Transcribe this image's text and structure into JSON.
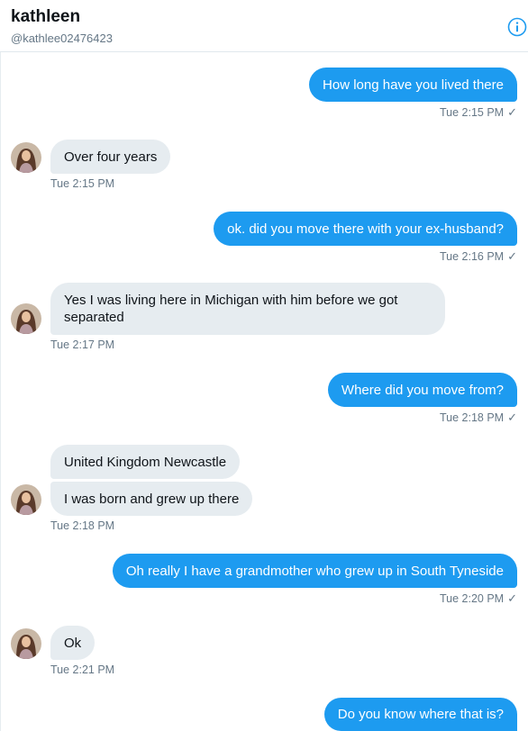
{
  "header": {
    "name": "kathleen",
    "handle": "@kathlee02476423"
  },
  "messages": [
    {
      "id": "m1",
      "direction": "out",
      "text": "How long have you lived there",
      "time": "Tue 2:15 PM",
      "read": "✓"
    },
    {
      "id": "m2",
      "direction": "in",
      "text": "Over four years",
      "time": "Tue 2:15 PM"
    },
    {
      "id": "m3",
      "direction": "out",
      "text": "ok. did you move there with your ex-husband?",
      "time": "Tue 2:16 PM",
      "read": "✓"
    },
    {
      "id": "m4",
      "direction": "in",
      "text": "Yes I was living here in Michigan with him before we got separated",
      "time": "Tue 2:17 PM"
    },
    {
      "id": "m5",
      "direction": "out",
      "text": "Where did you move from?",
      "time": "Tue 2:18 PM",
      "read": "✓"
    },
    {
      "id": "m6",
      "direction": "in",
      "text": "United Kingdom Newcastle"
    },
    {
      "id": "m7",
      "direction": "in",
      "text": "I was born and grew up there",
      "time": "Tue 2:18 PM"
    },
    {
      "id": "m8",
      "direction": "out",
      "text": "Oh really I have a grandmother who grew up in South Tyneside",
      "time": "Tue 2:20 PM",
      "read": "✓"
    },
    {
      "id": "m9",
      "direction": "in",
      "text": "Ok",
      "time": "Tue 2:21 PM"
    },
    {
      "id": "m10",
      "direction": "out",
      "text": "Do you know where that is?"
    }
  ],
  "icons": {
    "info": "info-icon",
    "avatar": "avatar"
  },
  "colors": {
    "outgoing_bubble": "#1d9bf0",
    "incoming_bubble": "#e6ecf0",
    "meta_text": "#657786"
  }
}
